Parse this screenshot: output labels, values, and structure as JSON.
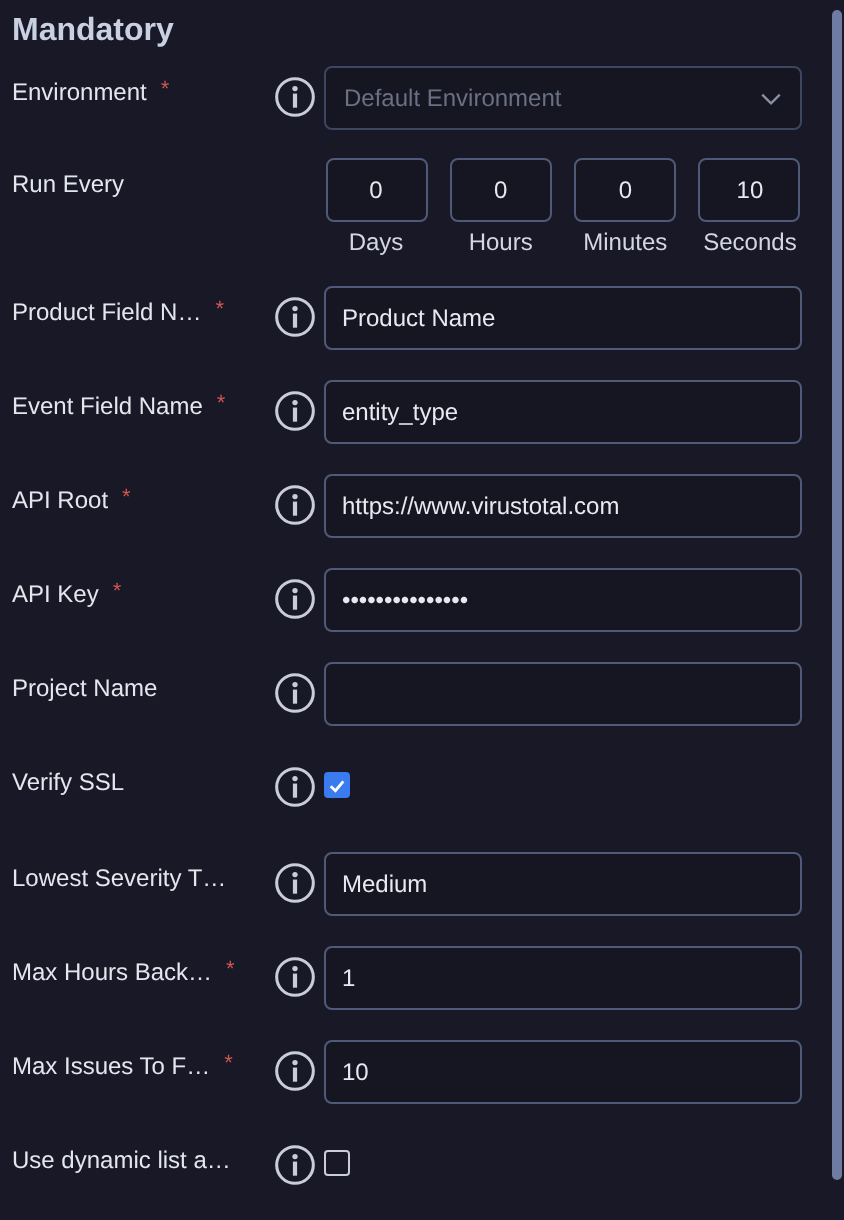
{
  "section_title": "Mandatory",
  "fields": [
    {
      "kind": "select",
      "label": "Environment",
      "required_mark": "*",
      "placeholder": "Default Environment"
    },
    {
      "kind": "timer",
      "label": "Run Every",
      "parts": [
        {
          "value": "0",
          "unit": "Days"
        },
        {
          "value": "0",
          "unit": "Hours"
        },
        {
          "value": "0",
          "unit": "Minutes"
        },
        {
          "value": "10",
          "unit": "Seconds"
        }
      ]
    },
    {
      "kind": "text",
      "label": "Product Field N…",
      "required_mark": "*",
      "value": "Product Name"
    },
    {
      "kind": "text",
      "label": "Event Field Name",
      "required_mark": "*",
      "value": "entity_type"
    },
    {
      "kind": "text",
      "label": "API Root",
      "required_mark": "*",
      "value": "https://www.virustotal.com"
    },
    {
      "kind": "text",
      "label": "API Key",
      "required_mark": "*",
      "value": "•••••••••••••••"
    },
    {
      "kind": "text",
      "label": "Project Name"
    },
    {
      "kind": "checkbox",
      "label": "Verify SSL",
      "checked": true
    },
    {
      "kind": "text",
      "label": "Lowest Severity T…",
      "value": "Medium"
    },
    {
      "kind": "text",
      "label": "Max Hours Back…",
      "required_mark": "*",
      "value": "1"
    },
    {
      "kind": "text",
      "label": "Max Issues To F…",
      "required_mark": "*",
      "value": "10"
    },
    {
      "kind": "checkbox",
      "label": "Use dynamic list a…",
      "checked": false
    }
  ]
}
